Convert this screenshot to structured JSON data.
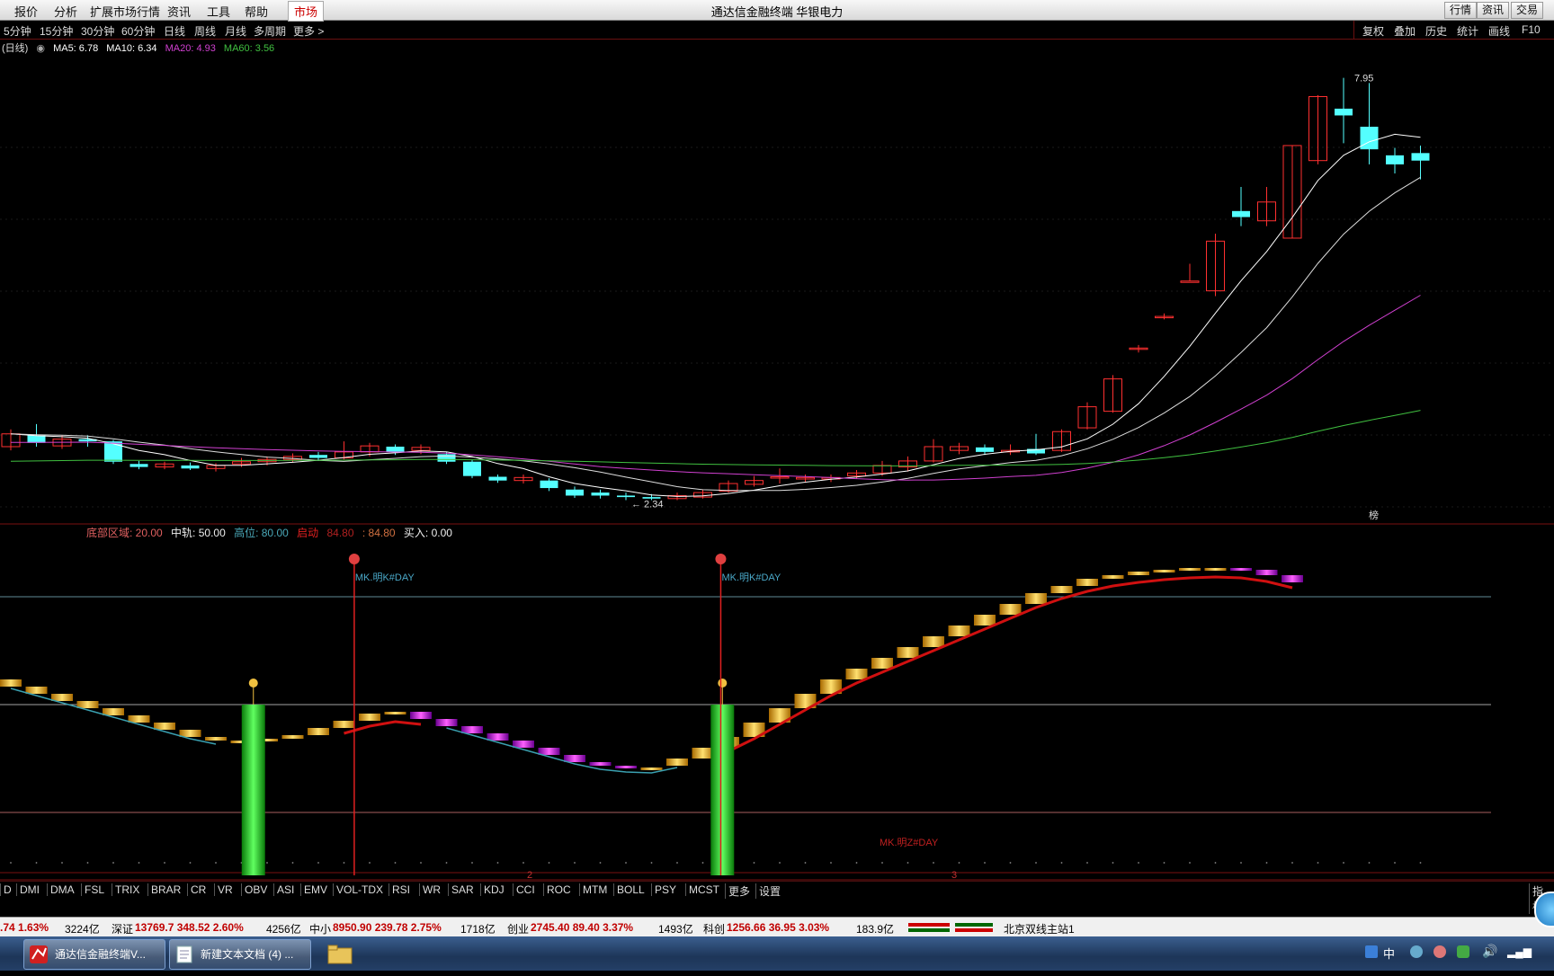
{
  "menu": {
    "items": [
      "报价",
      "分析",
      "扩展市场行情",
      "资讯",
      "工具",
      "帮助"
    ],
    "market_tab": "市场",
    "title": "通达信金融终端  华银电力",
    "right_buttons": [
      "行情",
      "资讯",
      "交易"
    ]
  },
  "periods": {
    "items": [
      "5分钟",
      "15分钟",
      "30分钟",
      "60分钟",
      "日线",
      "周线",
      "月线",
      "多周期",
      "更多 >"
    ],
    "right_items": [
      "复权",
      "叠加",
      "历史",
      "统计",
      "画线",
      "F10"
    ]
  },
  "ma_legend": {
    "period": "(日线)",
    "ma5": "MA5: 6.78",
    "ma10": "MA10: 6.34",
    "ma20": "MA20: 4.93",
    "ma60": "MA60: 3.56",
    "colors": {
      "ma5": "#ffffff",
      "ma10": "#ffffff",
      "ma20": "#d040d0",
      "ma60": "#40c040"
    }
  },
  "main_chart": {
    "high_label": "7.95",
    "low_label": "← 2.34",
    "marker_label": "榜",
    "up_color": "#ff3030",
    "down_color": "#54ffff"
  },
  "indicator": {
    "legend": {
      "bottom_zone": "底部区域: 20.00",
      "middle": "中轨: 50.00",
      "high": "高位: 80.00",
      "start_label": "启动",
      "start_value": "84.80",
      "value2": ": 84.80",
      "buy": "买入: 0.00"
    },
    "signal_labels": [
      "MK.明K#DAY",
      "MK.明K#DAY"
    ],
    "bottom_label": "MK.明Z#DAY",
    "axis_marks": [
      "2",
      "3"
    ]
  },
  "tabs": [
    "D",
    "DMI",
    "DMA",
    "FSL",
    "TRIX",
    "BRAR",
    "CR",
    "VR",
    "OBV",
    "ASI",
    "EMV",
    "VOL-TDX",
    "RSI",
    "WR",
    "SAR",
    "KDJ",
    "CCI",
    "ROC",
    "MTM",
    "BOLL",
    "PSY",
    "MCST",
    "更多",
    "设置"
  ],
  "tabs_right": "指标",
  "status": {
    "sh": ".74  1.63%",
    "sh_amt": "3224亿",
    "sz_label": "深证",
    "sz": "13769.7  348.52  2.60%",
    "sz_amt": "4256亿",
    "zx_label": "中小",
    "zx": "8950.90  239.78  2.75%",
    "zx_amt": "1718亿",
    "cy_label": "创业",
    "cy": "2745.40  89.40  3.37%",
    "cy_amt": "1493亿",
    "kc_label": "科创",
    "kc": "1256.66  36.95  3.03%",
    "kc_amt": "183.9亿",
    "server": "北京双线主站1"
  },
  "taskbar": {
    "items": [
      "通达信金融终端V...",
      "新建文本文档 (4) ..."
    ],
    "tray_lang": "中"
  },
  "candles": [
    [
      3.05,
      3.22,
      3.28,
      3.0
    ],
    [
      3.2,
      3.1,
      3.35,
      3.05
    ],
    [
      3.06,
      3.15,
      3.2,
      3.02
    ],
    [
      3.15,
      3.12,
      3.2,
      3.05
    ],
    [
      3.12,
      2.85,
      3.14,
      2.82
    ],
    [
      2.82,
      2.78,
      2.86,
      2.75
    ],
    [
      2.78,
      2.82,
      2.85,
      2.75
    ],
    [
      2.8,
      2.76,
      2.84,
      2.74
    ],
    [
      2.76,
      2.8,
      2.83,
      2.72
    ],
    [
      2.82,
      2.85,
      2.9,
      2.78
    ],
    [
      2.85,
      2.88,
      2.92,
      2.8
    ],
    [
      2.88,
      2.92,
      2.96,
      2.84
    ],
    [
      2.94,
      2.9,
      2.98,
      2.86
    ],
    [
      2.9,
      2.98,
      3.12,
      2.88
    ],
    [
      2.98,
      3.06,
      3.1,
      2.92
    ],
    [
      3.05,
      2.98,
      3.08,
      2.94
    ],
    [
      3.0,
      3.04,
      3.08,
      2.95
    ],
    [
      2.95,
      2.85,
      2.98,
      2.82
    ],
    [
      2.85,
      2.66,
      2.88,
      2.63
    ],
    [
      2.65,
      2.6,
      2.68,
      2.57
    ],
    [
      2.6,
      2.64,
      2.68,
      2.56
    ],
    [
      2.6,
      2.5,
      2.63,
      2.46
    ],
    [
      2.48,
      2.4,
      2.52,
      2.37
    ],
    [
      2.44,
      2.4,
      2.48,
      2.36
    ],
    [
      2.4,
      2.38,
      2.44,
      2.34
    ],
    [
      2.38,
      2.36,
      2.42,
      2.34
    ],
    [
      2.36,
      2.4,
      2.44,
      2.34
    ],
    [
      2.38,
      2.44,
      2.48,
      2.36
    ],
    [
      2.46,
      2.56,
      2.6,
      2.44
    ],
    [
      2.55,
      2.6,
      2.66,
      2.52
    ],
    [
      2.64,
      2.65,
      2.76,
      2.56
    ],
    [
      2.62,
      2.64,
      2.68,
      2.58
    ],
    [
      2.62,
      2.64,
      2.68,
      2.58
    ],
    [
      2.66,
      2.7,
      2.74,
      2.62
    ],
    [
      2.7,
      2.8,
      2.86,
      2.66
    ],
    [
      2.78,
      2.86,
      2.92,
      2.72
    ],
    [
      2.86,
      3.05,
      3.15,
      2.84
    ],
    [
      3.0,
      3.05,
      3.1,
      2.95
    ],
    [
      3.04,
      2.98,
      3.08,
      2.94
    ],
    [
      2.98,
      3.0,
      3.08,
      2.94
    ],
    [
      3.02,
      2.96,
      3.22,
      2.94
    ],
    [
      3.0,
      3.25,
      3.28,
      2.98
    ],
    [
      3.3,
      3.58,
      3.64,
      3.28
    ],
    [
      3.52,
      3.95,
      4.0,
      3.5
    ],
    [
      4.36,
      4.36,
      4.4,
      4.3
    ],
    [
      4.78,
      4.78,
      4.82,
      4.74
    ],
    [
      5.25,
      5.25,
      5.48,
      5.25
    ],
    [
      5.12,
      5.78,
      5.88,
      5.05
    ],
    [
      6.18,
      6.1,
      6.5,
      5.98
    ],
    [
      6.05,
      6.3,
      6.5,
      5.98
    ],
    [
      5.82,
      7.05,
      7.05,
      5.82
    ],
    [
      6.85,
      7.7,
      7.72,
      6.8
    ],
    [
      7.54,
      7.45,
      7.95,
      7.08
    ],
    [
      7.3,
      7.0,
      7.88,
      6.8
    ],
    [
      6.92,
      6.8,
      7.02,
      6.68
    ],
    [
      6.95,
      6.85,
      7.05,
      6.6
    ]
  ],
  "osc": [
    [
      55,
      57
    ],
    [
      53,
      55
    ],
    [
      51,
      53
    ],
    [
      49,
      51
    ],
    [
      47,
      49
    ],
    [
      45,
      47
    ],
    [
      43,
      45
    ],
    [
      41,
      43
    ],
    [
      40,
      41
    ],
    [
      40,
      40
    ],
    [
      40,
      40.5
    ],
    [
      40.5,
      41.5
    ],
    [
      41.5,
      43.5
    ],
    [
      43.5,
      45.5
    ],
    [
      45.5,
      47.5
    ],
    [
      47.5,
      48
    ],
    [
      48,
      46
    ],
    [
      46,
      44
    ],
    [
      44,
      42
    ],
    [
      42,
      40
    ],
    [
      40,
      38
    ],
    [
      38,
      36
    ],
    [
      36,
      34
    ],
    [
      34,
      33
    ],
    [
      33,
      32.5
    ],
    [
      32.5,
      32.5
    ],
    [
      33,
      35
    ],
    [
      35,
      38
    ],
    [
      38,
      41
    ],
    [
      41,
      45
    ],
    [
      45,
      49
    ],
    [
      49,
      53
    ],
    [
      53,
      57
    ],
    [
      57,
      60
    ],
    [
      60,
      63
    ],
    [
      63,
      66
    ],
    [
      66,
      69
    ],
    [
      69,
      72
    ],
    [
      72,
      75
    ],
    [
      75,
      78
    ],
    [
      78,
      81
    ],
    [
      81,
      83
    ],
    [
      83,
      85
    ],
    [
      85,
      86
    ],
    [
      86,
      87
    ],
    [
      87,
      87.5
    ],
    [
      87.5,
      88
    ],
    [
      88,
      88
    ],
    [
      88,
      87.5
    ],
    [
      87.5,
      86
    ],
    [
      86,
      84
    ]
  ]
}
